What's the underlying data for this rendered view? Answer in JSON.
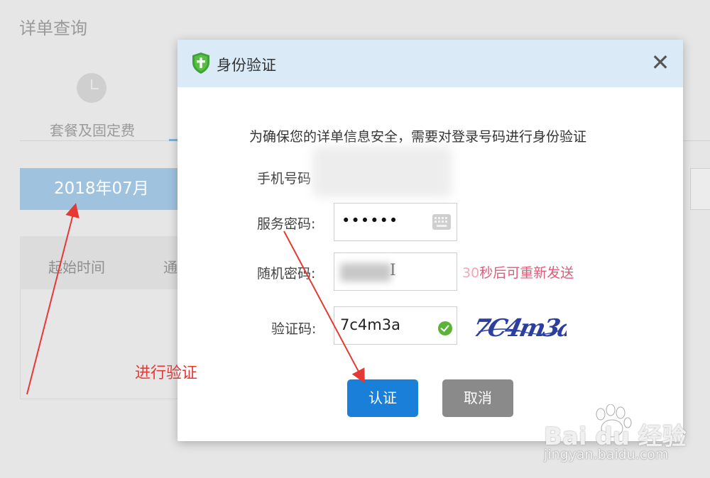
{
  "background": {
    "page_title": "详单查询",
    "tab_label": "套餐及固定费",
    "month_label": "2018年07月",
    "table_headers": [
      "起始时间",
      "通"
    ]
  },
  "annotation": {
    "text": "进行验证",
    "color": "#e53935"
  },
  "dialog": {
    "title": "身份验证",
    "close_symbol": "✕",
    "notice": "为确保您的详单信息安全，需要对登录号码进行身份验证",
    "phone_label": "手机号码",
    "password_label": "服务密码:",
    "password_value": "••••••",
    "random_label": "随机密码:",
    "resend_number": "30",
    "resend_text": "秒后可重新发送",
    "captcha_label": "验证码:",
    "captcha_value": "7c4m3a",
    "captcha_image_text": "7C4m3a",
    "confirm_button": "认证",
    "cancel_button": "取消"
  },
  "watermark": {
    "logo": "Bai du 经验",
    "url": "jingyan.baidu.com"
  },
  "colors": {
    "accent_blue": "#1a7fd9",
    "header_bg": "#dbeaf7",
    "resend_pink": "#e05a7a",
    "ok_green": "#5cb338"
  }
}
